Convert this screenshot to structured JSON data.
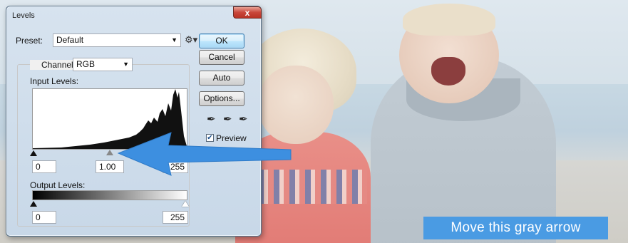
{
  "dialog": {
    "title": "Levels",
    "close_label": "x",
    "preset_label": "Preset:",
    "preset_value": "Default",
    "channel_label": "Channel:",
    "channel_value": "RGB",
    "input_levels_label": "Input Levels:",
    "input_black": "0",
    "input_gamma": "1.00",
    "input_white": "255",
    "output_levels_label": "Output Levels:",
    "output_black": "0",
    "output_white": "255",
    "buttons": {
      "ok": "OK",
      "cancel": "Cancel",
      "auto": "Auto",
      "options": "Options..."
    },
    "preview_label": "Preview",
    "preview_checked": true
  },
  "caption": "Move this gray arrow",
  "colors": {
    "arrow": "#3d8fe0",
    "caption_bg": "#4a9be3"
  }
}
